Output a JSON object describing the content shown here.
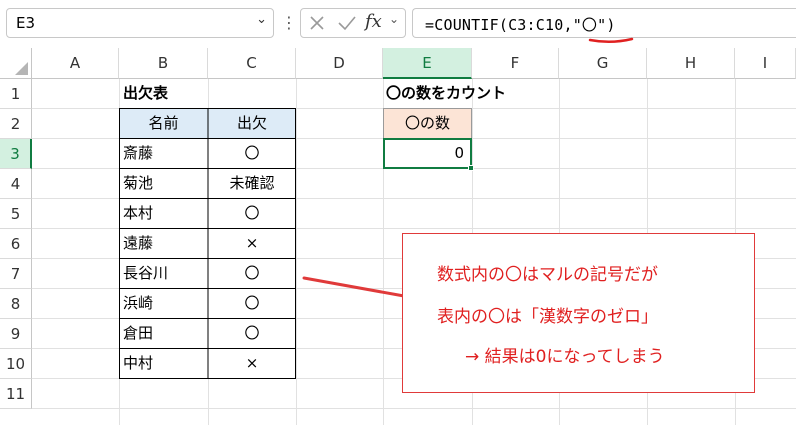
{
  "formula_bar": {
    "name_box": "E3",
    "formula_text": "=COUNTIF(C3:C10,\"〇\")"
  },
  "columns": [
    "A",
    "B",
    "C",
    "D",
    "E",
    "F",
    "G",
    "H",
    "I"
  ],
  "rows": [
    "1",
    "2",
    "3",
    "4",
    "5",
    "6",
    "7",
    "8",
    "9",
    "10",
    "11"
  ],
  "attendance": {
    "title": "出欠表",
    "headers": [
      "名前",
      "出欠"
    ],
    "rows": [
      [
        "斎藤",
        "〇"
      ],
      [
        "菊池",
        "未確認"
      ],
      [
        "本村",
        "〇"
      ],
      [
        "遠藤",
        "×"
      ],
      [
        "長谷川",
        "〇"
      ],
      [
        "浜崎",
        "〇"
      ],
      [
        "倉田",
        "〇"
      ],
      [
        "中村",
        "×"
      ]
    ]
  },
  "count_section": {
    "title": "〇の数をカウント",
    "header": "〇の数",
    "result": "0"
  },
  "annotation": {
    "line1": "数式内の〇はマルの記号だが",
    "line2": "表内の〇は「漢数字のゼロ」",
    "line3": "→ 結果は0になってしまう"
  },
  "colors": {
    "accent_green": "#107c41",
    "header_blue": "#ddebf7",
    "header_peach": "#fce4d6",
    "annotation_red": "#e02020"
  }
}
